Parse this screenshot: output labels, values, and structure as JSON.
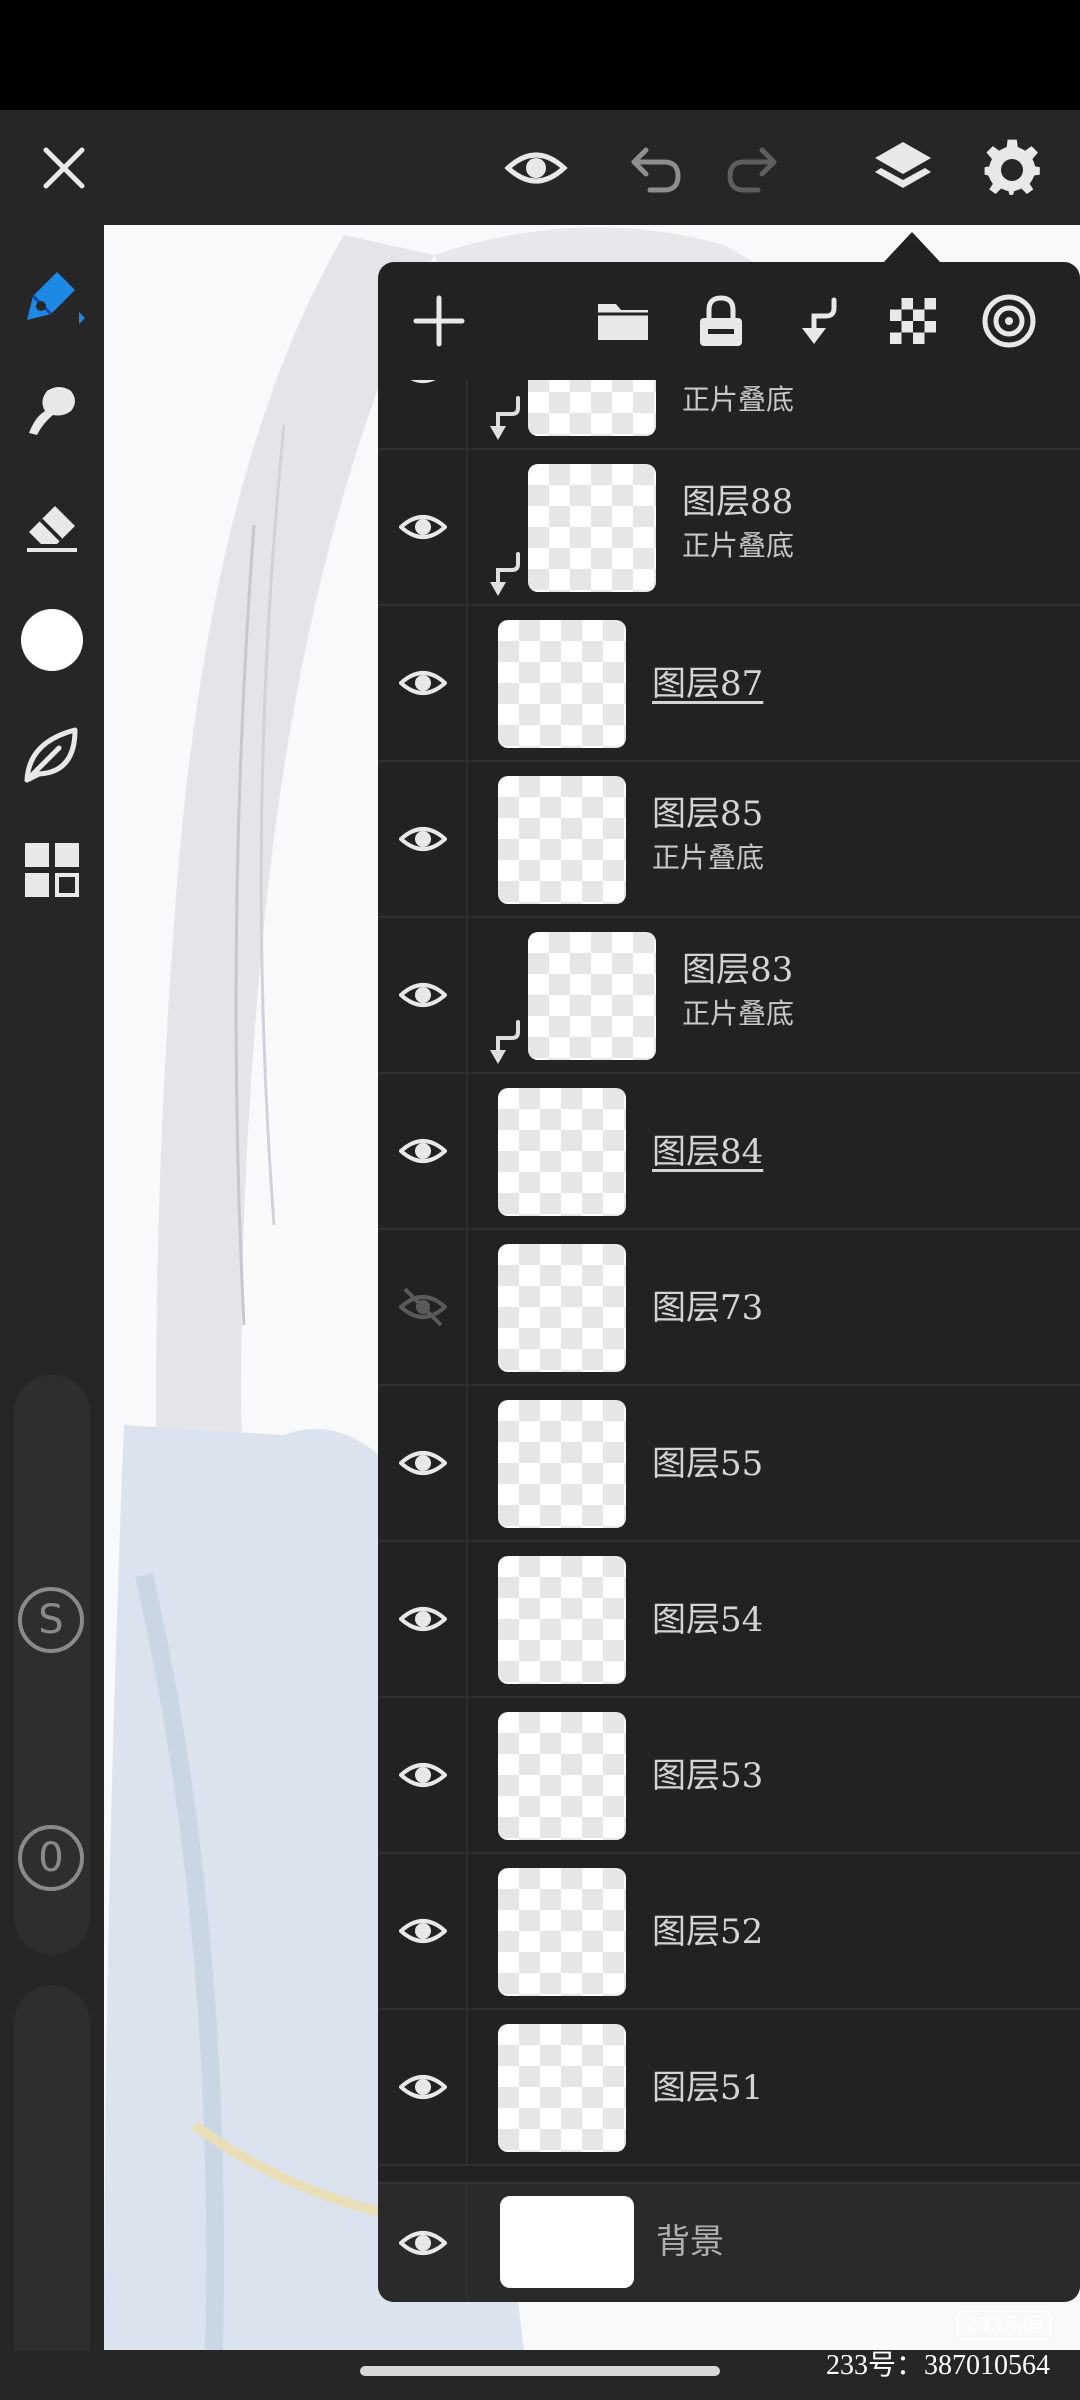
{
  "toolbar": {
    "close_icon": "close-icon",
    "preview_icon": "eye-icon",
    "undo_icon": "undo-icon",
    "redo_icon": "redo-icon",
    "layers_icon": "layers-icon",
    "settings_icon": "gear-icon"
  },
  "sidebar": {
    "tools": [
      "pen-tool-icon",
      "smudge-icon",
      "eraser-icon",
      "color-swatch",
      "leaf-brush-icon",
      "grid-icon"
    ],
    "size_knob_label": "S",
    "opacity_knob_label": "0"
  },
  "layers_panel": {
    "toolbar_icons": [
      "add-layer-icon",
      "folder-icon",
      "lock-icon",
      "clip-arrow-icon",
      "transparency-grid-icon",
      "target-icon"
    ],
    "layers": [
      {
        "name": "",
        "blend": "正片叠底",
        "visible": true,
        "clipped": true,
        "active": false
      },
      {
        "name": "图层88",
        "blend": "正片叠底",
        "visible": true,
        "clipped": true,
        "active": false
      },
      {
        "name": "图层87",
        "blend": "",
        "visible": true,
        "clipped": false,
        "active": true
      },
      {
        "name": "图层85",
        "blend": "正片叠底",
        "visible": true,
        "clipped": false,
        "active": false
      },
      {
        "name": "图层83",
        "blend": "正片叠底",
        "visible": true,
        "clipped": true,
        "active": false
      },
      {
        "name": "图层84",
        "blend": "",
        "visible": true,
        "clipped": false,
        "active": true
      },
      {
        "name": "图层73",
        "blend": "",
        "visible": false,
        "clipped": false,
        "active": false
      },
      {
        "name": "图层55",
        "blend": "",
        "visible": true,
        "clipped": false,
        "active": false
      },
      {
        "name": "图层54",
        "blend": "",
        "visible": true,
        "clipped": false,
        "active": false
      },
      {
        "name": "图层53",
        "blend": "",
        "visible": true,
        "clipped": false,
        "active": false
      },
      {
        "name": "图层52",
        "blend": "",
        "visible": true,
        "clipped": false,
        "active": false
      },
      {
        "name": "图层51",
        "blend": "",
        "visible": true,
        "clipped": false,
        "active": false
      }
    ],
    "background_layer": {
      "name": "背景",
      "visible": true
    }
  },
  "watermark": {
    "logo_text": "233乐园",
    "id_text": "233号：387010564"
  },
  "colors": {
    "accent": "#1e88e5",
    "toolbar_bg": "#262626",
    "panel_bg": "#222222",
    "text": "#d4d4d4"
  }
}
